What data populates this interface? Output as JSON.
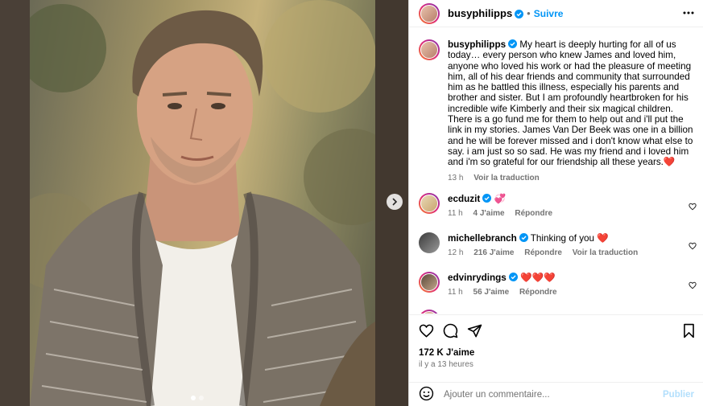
{
  "post": {
    "author": "busyphilipps",
    "follow_label": "Suivre",
    "separator": "•",
    "caption": "My heart is deeply hurting for all of us today… every person who knew James and loved him, anyone who loved his work or had the pleasure of meeting him, all of his dear friends and community that surrounded him as he battled this illness, especially his parents and brother and sister. But I am profoundly heartbroken for his incredible wife Kimberly and their six magical children. There is a go fund me for them to help out and i'll put the link in my stories. James Van Der Beek was one in a billion and he will be forever missed and i don't know what else to say. i am just so so sad. He was my friend and i loved him and i'm so grateful for our friendship all these years.❤️",
    "caption_age": "13 h",
    "translate_label": "Voir la traduction",
    "likes": "172 K J'aime",
    "timestamp": "il y a 13 heures"
  },
  "comments": [
    {
      "user": "ecduzit",
      "text": "💞",
      "age": "11 h",
      "likes": "4 J'aime",
      "reply": "Répondre",
      "translate": ""
    },
    {
      "user": "michellebranch",
      "text": "Thinking of you ❤️",
      "age": "12 h",
      "likes": "216 J'aime",
      "reply": "Répondre",
      "translate": "Voir la traduction"
    },
    {
      "user": "edvinrydings",
      "text": "❤️❤️❤️",
      "age": "11 h",
      "likes": "56 J'aime",
      "reply": "Répondre",
      "translate": ""
    }
  ],
  "composer": {
    "placeholder": "Ajouter un commentaire...",
    "publish_label": "Publier"
  },
  "carousel": {
    "count": 2,
    "active": 1
  },
  "colors": {
    "link": "#0095f6",
    "verified": "#0095f6",
    "publish_disabled": "#b2dffc"
  }
}
